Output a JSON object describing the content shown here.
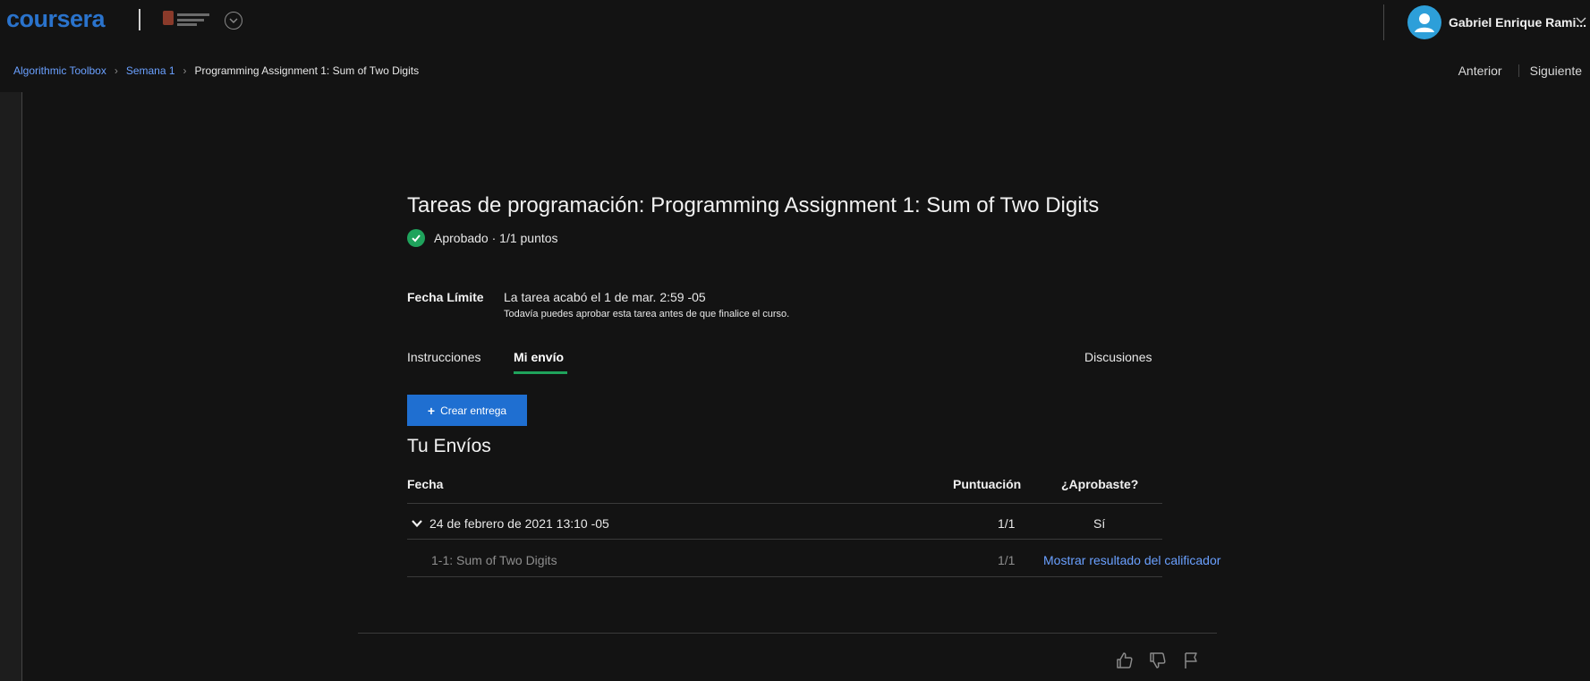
{
  "header": {
    "logo_text": "coursera",
    "brand_color": "#2a73cc",
    "user_name": "Gabriel Enrique Rami..."
  },
  "breadcrumb": {
    "course": "Algorithmic Toolbox",
    "week": "Semana 1",
    "current": "Programming Assignment 1: Sum of Two Digits"
  },
  "nav": {
    "prev": "Anterior",
    "next": "Siguiente"
  },
  "assignment": {
    "title": "Tareas de programación: Programming Assignment 1: Sum of Two Digits",
    "status": "Aprobado · 1/1 puntos",
    "deadline_label": "Fecha Límite",
    "deadline_value": "La tarea acabó el 1 de mar. 2:59 -05",
    "deadline_note": "Todavía puedes aprobar esta tarea antes de que finalice el curso."
  },
  "tabs": {
    "instructions": "Instrucciones",
    "my_submission": "Mi envío",
    "discussions": "Discusiones"
  },
  "actions": {
    "create_submission": "Crear entrega"
  },
  "submissions": {
    "heading": "Tu Envíos",
    "columns": {
      "date": "Fecha",
      "score": "Puntuación",
      "passed": "¿Aprobaste?"
    },
    "rows": [
      {
        "date": "24 de febrero de 2021 13:10 -05",
        "score": "1/1",
        "passed": "Sí"
      }
    ],
    "parts": [
      {
        "name": "1-1: Sum of Two Digits",
        "score": "1/1",
        "action": "Mostrar resultado del calificador"
      }
    ]
  },
  "icons": {
    "expand": "chevron-down-icon",
    "status": "check-circle-icon",
    "like": "thumbs-up-icon",
    "dislike": "thumbs-down-icon",
    "flag": "flag-icon"
  },
  "colors": {
    "success": "#1fa35c",
    "link": "#6aa0ff",
    "primary_button": "#1f6fd1",
    "background": "#131313"
  }
}
